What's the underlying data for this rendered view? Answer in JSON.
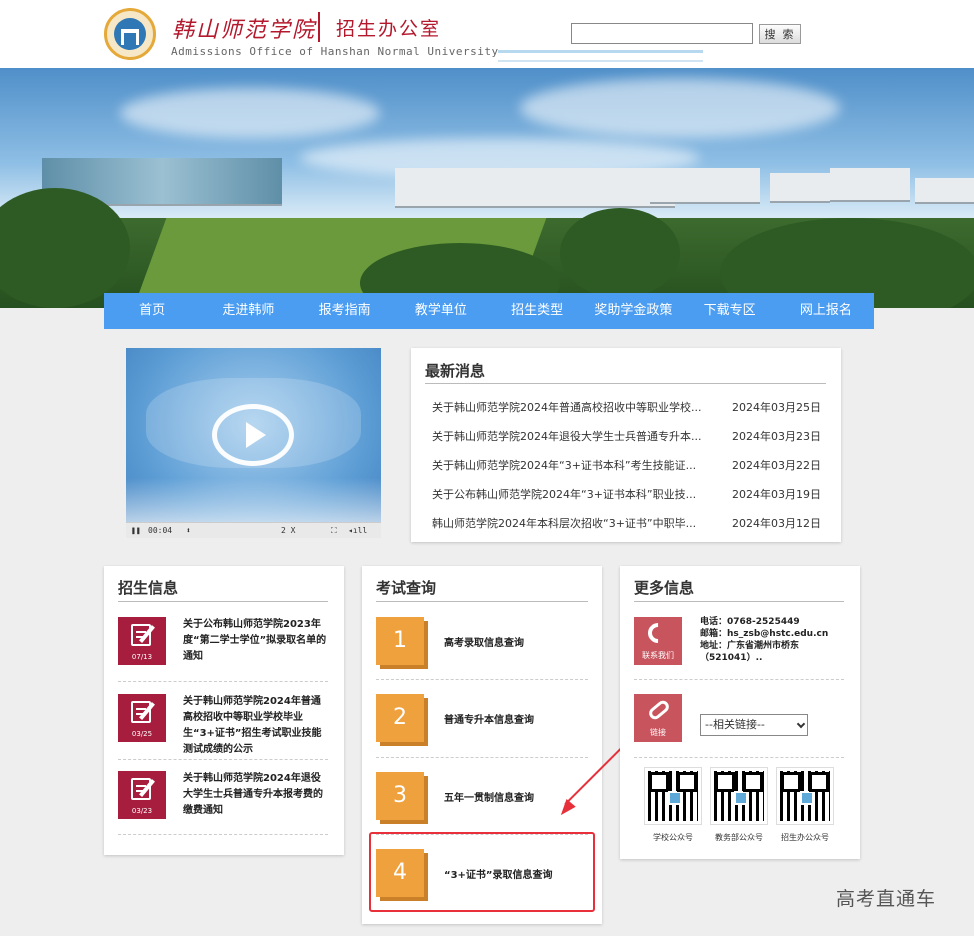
{
  "header": {
    "logo_cn": "韩山师范学院",
    "office": "招生办公室",
    "logo_en": "Admissions Office of Hanshan Normal University",
    "search_value": "",
    "search_button": "搜 索"
  },
  "nav": {
    "items": [
      "首页",
      "走进韩师",
      "报考指南",
      "教学单位",
      "招生类型",
      "奖助学金政策",
      "下载专区",
      "网上报名"
    ]
  },
  "video": {
    "time": "00:04",
    "speed": "2 X"
  },
  "news": {
    "title": "最新消息",
    "items": [
      {
        "title": "关于韩山师范学院2024年普通高校招收中等职业学校...",
        "date": "2024年03月25日"
      },
      {
        "title": "关于韩山师范学院2024年退役大学生士兵普通专升本...",
        "date": "2024年03月23日"
      },
      {
        "title": "关于韩山师范学院2024年“3+证书本科”考生技能证...",
        "date": "2024年03月22日"
      },
      {
        "title": "关于公布韩山师范学院2024年“3+证书本科”职业技...",
        "date": "2024年03月19日"
      },
      {
        "title": "韩山师范学院2024年本科层次招收“3+证书”中职毕...",
        "date": "2024年03月12日"
      }
    ]
  },
  "admissions": {
    "title": "招生信息",
    "items": [
      {
        "text": "关于公布韩山师范学院2023年度“第二学士学位”拟录取名单的通知",
        "date": "07/13"
      },
      {
        "text": "关于韩山师范学院2024年普通高校招收中等职业学校毕业生“3+证书”招生考试职业技能测试成绩的公示",
        "date": "03/25"
      },
      {
        "text": "关于韩山师范学院2024年退役大学生士兵普通专升本报考费的缴费通知",
        "date": "03/23"
      }
    ]
  },
  "exam": {
    "title": "考试查询",
    "items": [
      {
        "num": "1",
        "label": "高考录取信息查询"
      },
      {
        "num": "2",
        "label": "普通专升本信息查询"
      },
      {
        "num": "3",
        "label": "五年一贯制信息查询"
      },
      {
        "num": "4",
        "label": "“3+证书”录取信息查询"
      }
    ]
  },
  "more": {
    "title": "更多信息",
    "contact_label": "联系我们",
    "phone": "电话：0768-2525449",
    "email": "邮箱：hs_zsb@hstc.edu.cn",
    "address": "地址：广东省潮州市桥东（521041）..",
    "link_label": "链接",
    "select_value": "--相关链接--",
    "qr": [
      "学校公众号",
      "教务部公众号",
      "招生办公众号"
    ]
  },
  "watermark": "高考直通车",
  "colors": {
    "nav": "#4b9df2",
    "admissions_icon": "#a71d3e",
    "exam_number": "#eea13d",
    "more_icon": "#c8545e",
    "highlight": "#e8303a",
    "logo": "#b4182c"
  }
}
